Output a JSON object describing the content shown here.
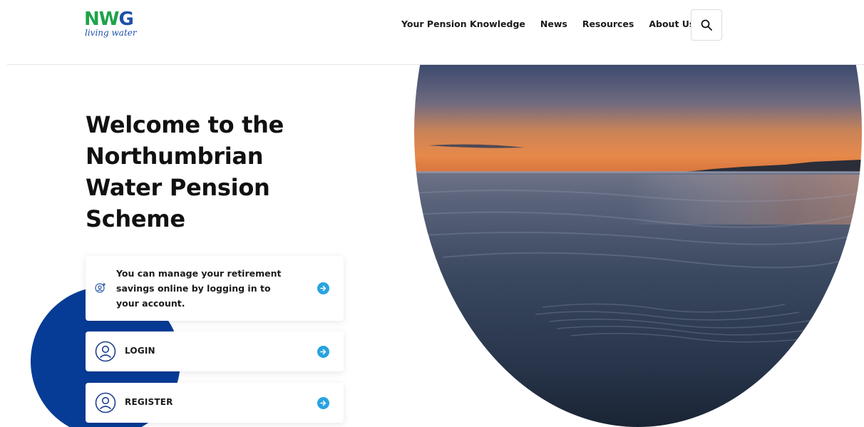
{
  "logo": {
    "word_n": "N",
    "word_w": "W",
    "word_g": "G",
    "tagline": "living water"
  },
  "nav": {
    "items": [
      "Your Pension Knowledge",
      "News",
      "Resources",
      "About Us"
    ]
  },
  "hero": {
    "title": "Welcome to the Northumbrian Water Pension Scheme"
  },
  "info_card": {
    "text": "You can manage your retirement savings online by logging in to your account."
  },
  "login_card": {
    "label": "LOGIN"
  },
  "register_card": {
    "label": "REGISTER"
  },
  "colors": {
    "brand_green": "#1ea34b",
    "brand_blue": "#063c96",
    "accent_blue": "#2aa3e0"
  },
  "icons": {
    "search": "search-icon",
    "account_add": "user-add-icon",
    "user": "user-circle-icon",
    "arrow": "arrow-right-circle-icon"
  }
}
